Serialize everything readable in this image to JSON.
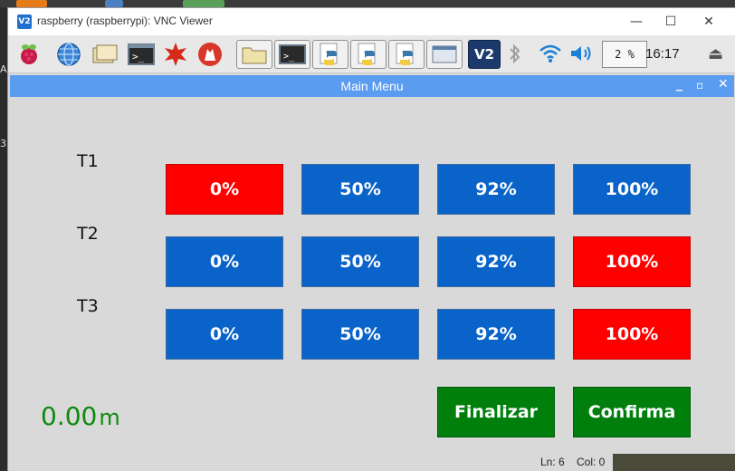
{
  "vnc": {
    "title": "raspberry (raspberrypi): VNC Viewer",
    "logo": "V2",
    "controls": {
      "minimize": "—",
      "maximize": "☐",
      "close": "✕"
    }
  },
  "taskbar": {
    "icons": [
      "raspberry-menu-icon",
      "globe-browser-icon",
      "file-manager-icon",
      "terminal-icon",
      "mathematica-icon",
      "wolfram-icon",
      "folder-window-icon",
      "terminal-window-icon",
      "python-window-icon",
      "python-window-icon",
      "python-window-icon",
      "window-icon",
      "vnc-icon",
      "bluetooth-icon",
      "wifi-icon",
      "volume-icon"
    ],
    "cpu": "2 %",
    "clock": "16:17"
  },
  "app": {
    "title": "Main Menu",
    "controls": {
      "minimize": "_",
      "maximize": "▫",
      "close": "✕"
    },
    "rows": [
      {
        "label": "T1",
        "buttons": [
          {
            "label": "0%",
            "state": "red"
          },
          {
            "label": "50%",
            "state": "blue"
          },
          {
            "label": "92%",
            "state": "blue"
          },
          {
            "label": "100%",
            "state": "blue"
          }
        ]
      },
      {
        "label": "T2",
        "buttons": [
          {
            "label": "0%",
            "state": "blue"
          },
          {
            "label": "50%",
            "state": "blue"
          },
          {
            "label": "92%",
            "state": "blue"
          },
          {
            "label": "100%",
            "state": "red"
          }
        ]
      },
      {
        "label": "T3",
        "buttons": [
          {
            "label": "0%",
            "state": "blue"
          },
          {
            "label": "50%",
            "state": "blue"
          },
          {
            "label": "92%",
            "state": "blue"
          },
          {
            "label": "100%",
            "state": "red"
          }
        ]
      }
    ],
    "meter": {
      "value": "0.00",
      "unit": "m"
    },
    "finalizar_label": "Finalizar",
    "confirma_label": "Confirma"
  },
  "status": {
    "ln": "Ln: 6",
    "col": "Col: 0"
  },
  "colors": {
    "accent_blue": "#0a63c8",
    "selected_red": "#ff0000",
    "action_green": "#007f0d",
    "title_blue": "#5a9cf0"
  }
}
